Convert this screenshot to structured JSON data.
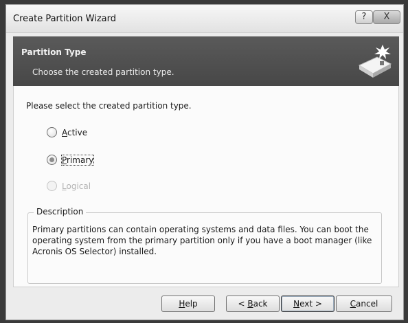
{
  "window": {
    "title": "Create Partition Wizard",
    "help_glyph": "?",
    "close_glyph": "X"
  },
  "header": {
    "title": "Partition Type",
    "subtitle": "Choose the created partition type."
  },
  "body": {
    "prompt": "Please select the created partition type.",
    "options": [
      {
        "first": "A",
        "rest": "ctive",
        "checked": false,
        "enabled": true
      },
      {
        "first": "P",
        "rest": "rimary",
        "checked": true,
        "enabled": true
      },
      {
        "first": "L",
        "rest": "ogical",
        "checked": false,
        "enabled": false
      }
    ],
    "description": {
      "legend": "Description",
      "text": "Primary partitions can contain operating systems and data files. You can boot the operating system from the primary partition only if you have a boot manager (like Acronis OS Selector) installed."
    }
  },
  "footer": {
    "help": {
      "first": "H",
      "rest": "elp"
    },
    "back": {
      "prefix": "< ",
      "first": "B",
      "rest": "ack"
    },
    "next": {
      "first": "N",
      "rest": "ext >"
    },
    "cancel": {
      "first": "C",
      "rest": "ancel"
    }
  }
}
